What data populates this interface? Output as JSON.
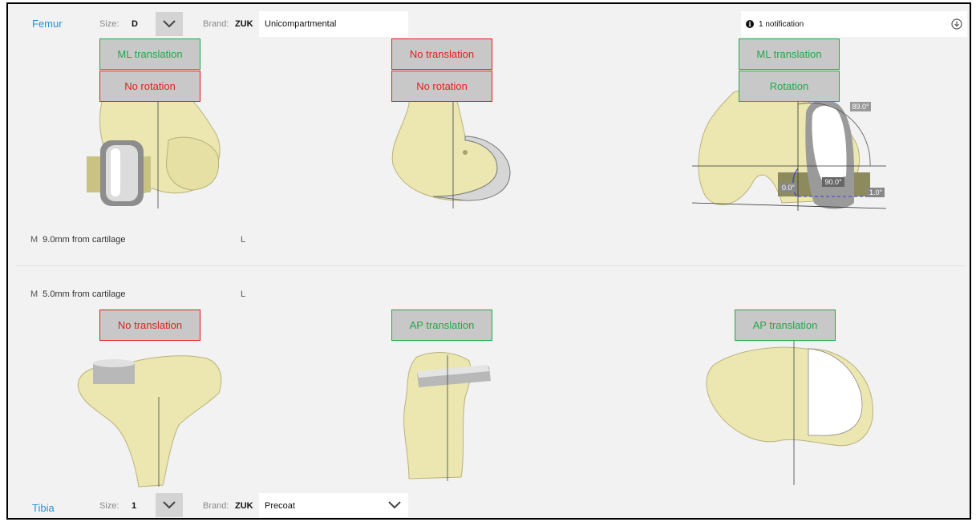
{
  "femur": {
    "title": "Femur",
    "size_label": "Size:",
    "size_value": "D",
    "brand_label": "Brand:",
    "brand_value": "ZUK",
    "implant_type": "Unicompartmental",
    "notification": "1 notification",
    "side_medial": "M",
    "side_lateral": "L",
    "distance_text": "9.0mm from cartilage",
    "views": [
      {
        "boxes": [
          {
            "label": "ML translation",
            "status": "ok"
          },
          {
            "label": "No rotation",
            "status": "bad"
          }
        ]
      },
      {
        "boxes": [
          {
            "label": "No translation",
            "status": "bad"
          },
          {
            "label": "No rotation",
            "status": "bad"
          }
        ]
      },
      {
        "boxes": [
          {
            "label": "ML translation",
            "status": "ok"
          },
          {
            "label": "Rotation",
            "status": "ok"
          }
        ]
      }
    ],
    "angles": {
      "a1": "89.0°",
      "a2": "90.0°",
      "a3": "0.0°",
      "a4": "1.0°"
    }
  },
  "tibia": {
    "title": "Tibia",
    "size_label": "Size:",
    "size_value": "1",
    "brand_label": "Brand:",
    "brand_value": "ZUK",
    "implant_type": "Precoat",
    "side_medial": "M",
    "side_lateral": "L",
    "distance_text": "5.0mm from cartilage",
    "views": [
      {
        "boxes": [
          {
            "label": "No translation",
            "status": "bad"
          }
        ]
      },
      {
        "boxes": [
          {
            "label": "AP translation",
            "status": "ok"
          }
        ]
      },
      {
        "boxes": [
          {
            "label": "AP translation",
            "status": "ok"
          }
        ]
      }
    ]
  },
  "colors": {
    "ok": "#22a84a",
    "bad": "#e02020",
    "title": "#2b8fd6",
    "bone": "#ece7b0",
    "bone_shadow": "#c9c383"
  },
  "icons": {
    "dropdown": "chevron-down-icon",
    "info": "info-icon",
    "download": "download-circle-icon"
  }
}
